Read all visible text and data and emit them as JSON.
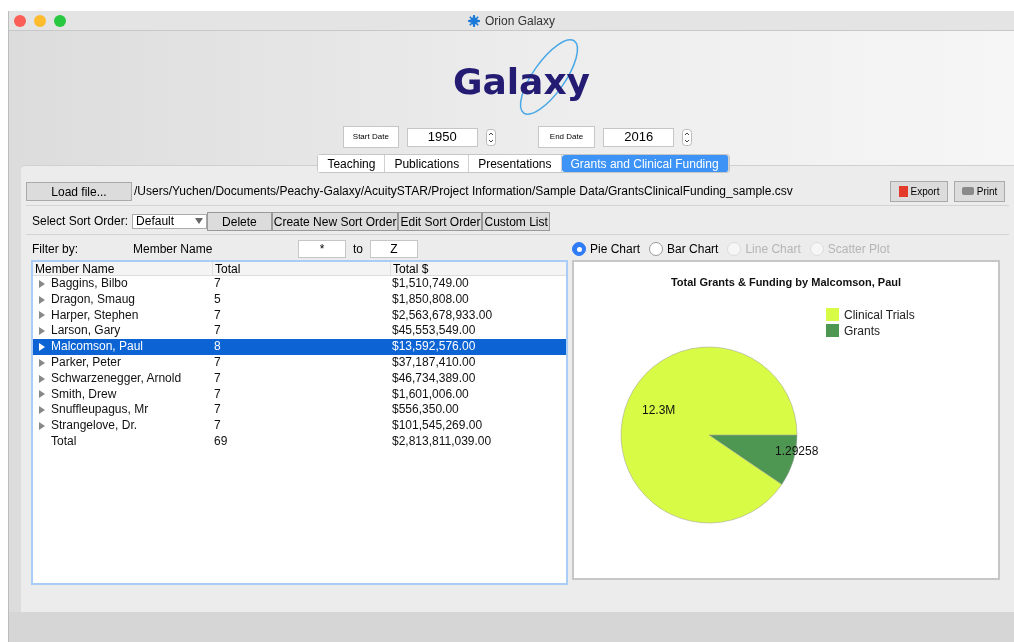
{
  "window": {
    "title": "Orion Galaxy"
  },
  "logo": {
    "text": "Galaxy"
  },
  "dates": {
    "start_label": "Start Date",
    "start_value": "1950",
    "end_label": "End Date",
    "end_value": "2016"
  },
  "tabs": [
    {
      "label": "Teaching",
      "selected": false
    },
    {
      "label": "Publications",
      "selected": false
    },
    {
      "label": "Presentations",
      "selected": false
    },
    {
      "label": "Grants and Clinical Funding",
      "selected": true
    }
  ],
  "file": {
    "button": "Load file...",
    "path": "/Users/Yuchen/Documents/Peachy-Galaxy/AcuitySTAR/Project Information/Sample Data/GrantsClinicalFunding_sample.csv",
    "export": "Export",
    "print": "Print"
  },
  "sort": {
    "label": "Select Sort Order:",
    "value": "Default",
    "buttons": [
      "Delete",
      "Create New Sort Order",
      "Edit Sort Order",
      "Custom List"
    ]
  },
  "filter": {
    "label": "Filter by:",
    "field": "Member Name",
    "from": "*",
    "to_label": "to",
    "to": "Z"
  },
  "chart_types": [
    {
      "label": "Pie Chart",
      "selected": true,
      "disabled": false
    },
    {
      "label": "Bar Chart",
      "selected": false,
      "disabled": false
    },
    {
      "label": "Line Chart",
      "selected": false,
      "disabled": true
    },
    {
      "label": "Scatter Plot",
      "selected": false,
      "disabled": true
    }
  ],
  "table": {
    "columns": [
      "Member Name",
      "Total",
      "Total $"
    ],
    "rows": [
      {
        "name": "Baggins, Bilbo",
        "total": "7",
        "amount": "$1,510,749.00",
        "selected": false,
        "expandable": true
      },
      {
        "name": "Dragon, Smaug",
        "total": "5",
        "amount": "$1,850,808.00",
        "selected": false,
        "expandable": true
      },
      {
        "name": "Harper, Stephen",
        "total": "7",
        "amount": "$2,563,678,933.00",
        "selected": false,
        "expandable": true
      },
      {
        "name": "Larson, Gary",
        "total": "7",
        "amount": "$45,553,549.00",
        "selected": false,
        "expandable": true
      },
      {
        "name": "Malcomson, Paul",
        "total": "8",
        "amount": "$13,592,576.00",
        "selected": true,
        "expandable": true
      },
      {
        "name": "Parker, Peter",
        "total": "7",
        "amount": "$37,187,410.00",
        "selected": false,
        "expandable": true
      },
      {
        "name": "Schwarzenegger, Arnold",
        "total": "7",
        "amount": "$46,734,389.00",
        "selected": false,
        "expandable": true
      },
      {
        "name": "Smith, Drew",
        "total": "7",
        "amount": "$1,601,006.00",
        "selected": false,
        "expandable": true
      },
      {
        "name": "Snuffleupagus, Mr",
        "total": "7",
        "amount": "$556,350.00",
        "selected": false,
        "expandable": true
      },
      {
        "name": "Strangelove, Dr.",
        "total": "7",
        "amount": "$101,545,269.00",
        "selected": false,
        "expandable": true
      },
      {
        "name": "Total",
        "total": "69",
        "amount": "$2,813,811,039.00",
        "selected": false,
        "expandable": false
      }
    ]
  },
  "chart": {
    "chart_data": {
      "type": "pie",
      "title": "Total Grants & Funding by Malcomson, Paul",
      "categories": [
        "Clinical Trials",
        "Grants"
      ],
      "values": [
        12.3,
        1.29258
      ],
      "colors": [
        "#d8fb45",
        "#4e9752"
      ],
      "value_labels": [
        "12.3M",
        "1.29258"
      ],
      "legend": true
    }
  }
}
